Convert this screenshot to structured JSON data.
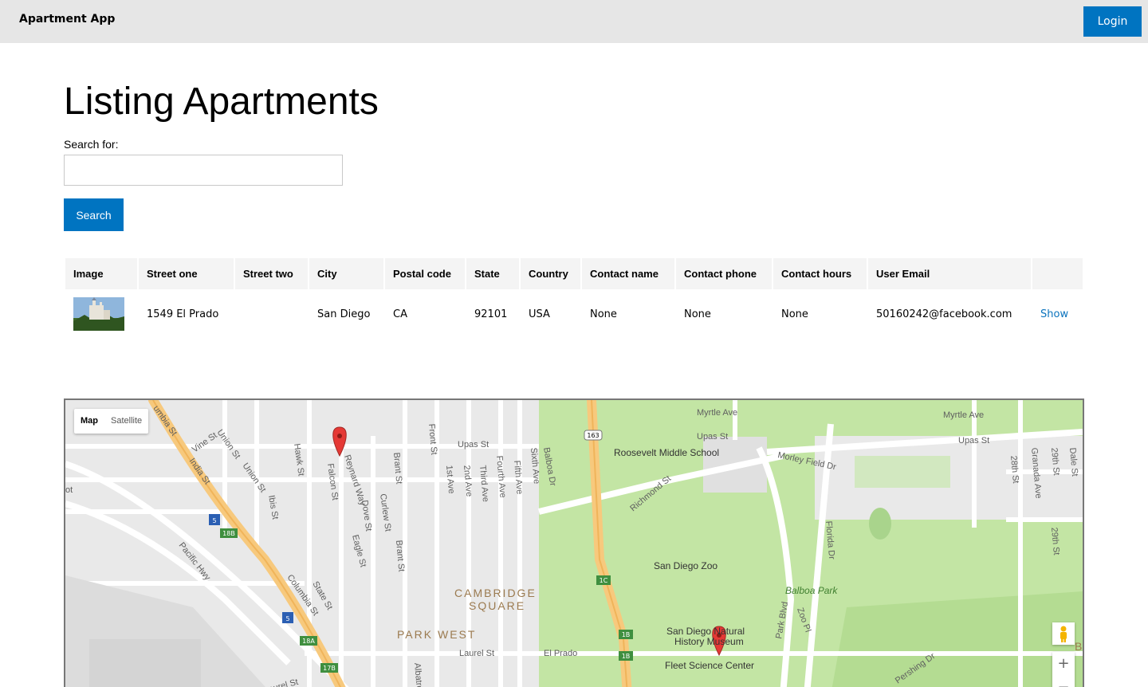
{
  "header": {
    "brand": "Apartment App",
    "login_label": "Login"
  },
  "page": {
    "title": "Listing Apartments",
    "search_label": "Search for:",
    "search_value": "",
    "search_button": "Search"
  },
  "table": {
    "headers": [
      "Image",
      "Street one",
      "Street two",
      "City",
      "Postal code",
      "State",
      "Country",
      "Contact name",
      "Contact phone",
      "Contact hours",
      "User Email",
      ""
    ],
    "rows": [
      {
        "street_one": "1549 El Prado",
        "street_two": "",
        "city": "San Diego",
        "postal_code": "CA",
        "state": "92101",
        "country": "USA",
        "contact_name": "None",
        "contact_phone": "None",
        "contact_hours": "None",
        "user_email": "50160242@facebook.com",
        "action": "Show"
      }
    ]
  },
  "map": {
    "type_control": {
      "map": "Map",
      "satellite": "Satellite"
    },
    "zoom": {
      "in": "+",
      "out": "−"
    },
    "labels": {
      "myrtle_ave_1": "Myrtle Ave",
      "myrtle_ave_2": "Myrtle Ave",
      "upas_st_1": "Upas St",
      "upas_st_2": "Upas St",
      "upas_st_3": "Upas St",
      "roosevelt": "Roosevelt Middle School",
      "morley": "Morley Field Dr",
      "richmond": "Richmond St",
      "zoo": "San Diego Zoo",
      "balboa_park": "Balboa Park",
      "cambridge_1": "CAMBRIDGE",
      "cambridge_2": "SQUARE",
      "park_west": "PARK WEST",
      "museum_1": "San Diego Natural",
      "museum_2": "History Museum",
      "fleet": "Fleet Science Center",
      "el_prado": "El Prado",
      "laurel_st_1": "Laurel St",
      "laurel_st_2": "Laurel St",
      "pacific_hwy": "Pacific Hwy",
      "columbia_st": "Columbia St",
      "state_st": "State St",
      "union_st": "Union St",
      "hawk_st": "Hawk St",
      "falcon_st": "Falcon St",
      "reynard": "Reynard Way",
      "dove_st": "Dove St",
      "curlew_st": "Curlew St",
      "eagle_st": "Eagle St",
      "brant_st": "Brant St",
      "front_st": "Front St",
      "first_ave": "1st Ave",
      "second_ave": "2nd Ave",
      "third_ave": "Third Ave",
      "fourth_ave": "Fourth Ave",
      "fifth_ave": "Fifth Ave",
      "sixth_ave": "Sixth Ave",
      "balboa_dr": "Balboa Dr",
      "park_blvd": "Park Blvd",
      "zoo_pl": "Zoo Pl",
      "florida_dr": "Florida Dr",
      "pershing_dr": "Pershing Dr",
      "granada_ave": "Granada Ave",
      "twentyninth": "29th St",
      "twentyeighth": "28th St",
      "india_st": "India St",
      "vine_st": "Vine St",
      "kettner": "umbia St",
      "ibis_st": "Ibis St",
      "dale_st": "Dale St",
      "albatross": "Albatross",
      "shield_163": "163",
      "shield_5a": "5",
      "shield_5b": "5",
      "exit_18b": "18B",
      "exit_18a": "18A",
      "exit_17b": "17B",
      "exit_1c": "1C",
      "exit_1b_a": "1B",
      "exit_1b_b": "1B",
      "ot": "ot",
      "b_edge": "B"
    }
  },
  "colors": {
    "accent": "#0074c1",
    "park": "#c3e5a4",
    "road": "#ffffff",
    "highway": "#f7c97d",
    "marker": "#e53935"
  }
}
